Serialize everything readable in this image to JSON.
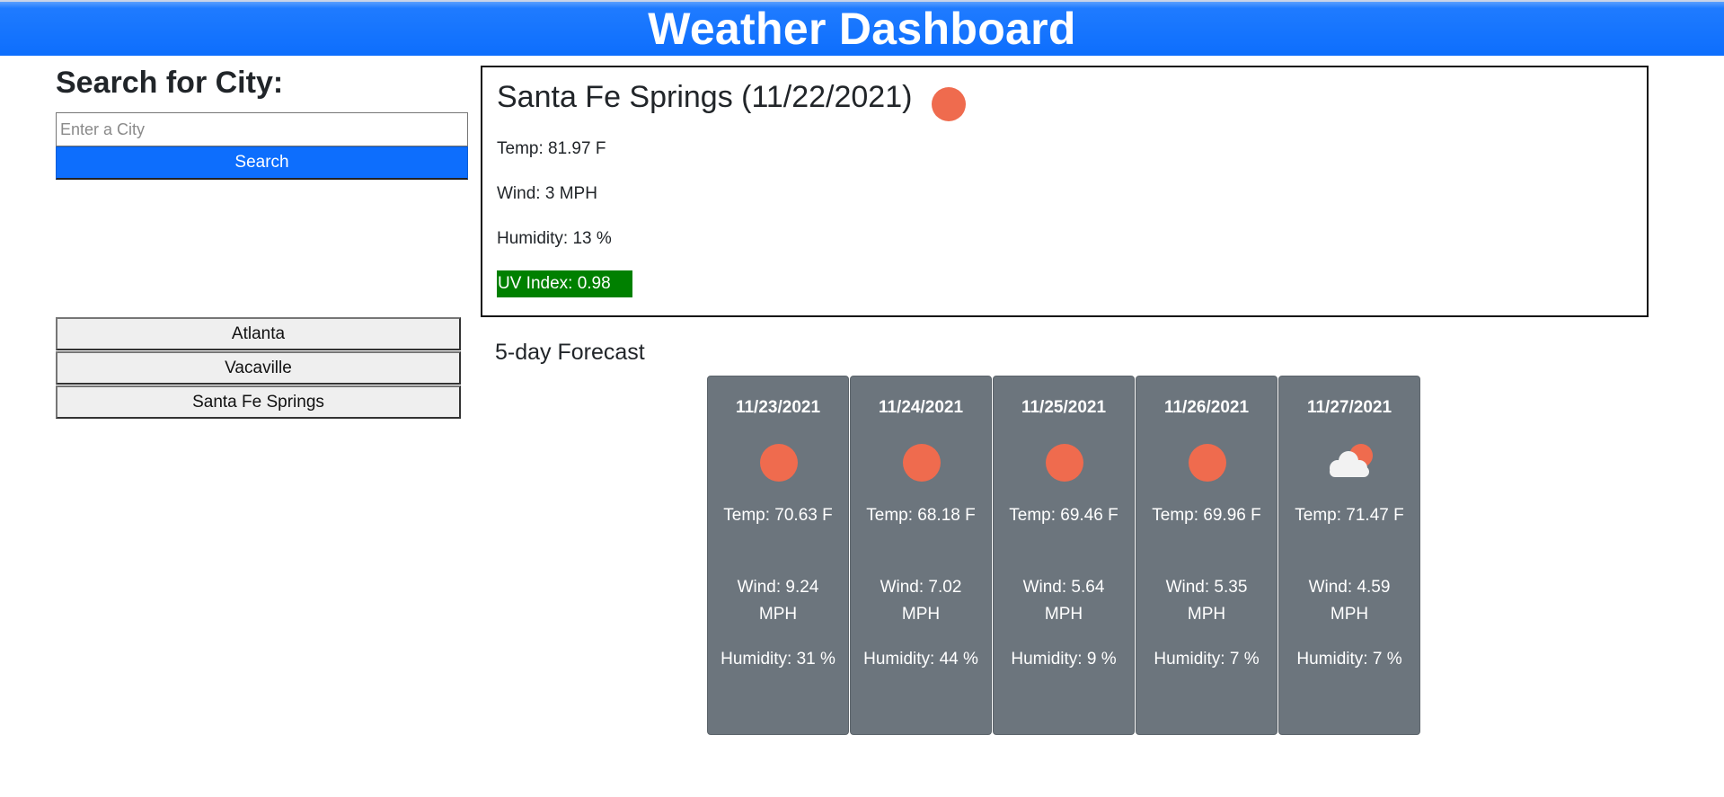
{
  "header": {
    "title": "Weather Dashboard"
  },
  "search": {
    "title": "Search for City:",
    "placeholder": "Enter a City",
    "value": "",
    "button_label": "Search"
  },
  "history": [
    "Atlanta",
    "Vacaville",
    "Santa Fe Springs"
  ],
  "current": {
    "title": "Santa Fe Springs (11/22/2021)",
    "icon": "sun-icon",
    "temp": "Temp: 81.97 F",
    "wind": "Wind: 3 MPH",
    "humidity": "Humidity: 13 %",
    "uv": "UV Index: 0.98",
    "uv_color": "#008000"
  },
  "forecast": {
    "title": "5-day Forecast",
    "days": [
      {
        "date": "11/23/2021",
        "icon": "sun-icon",
        "temp": "Temp: 70.63 F",
        "wind": "Wind: 9.24 MPH",
        "humidity": "Humidity: 31 %"
      },
      {
        "date": "11/24/2021",
        "icon": "sun-icon",
        "temp": "Temp: 68.18 F",
        "wind": "Wind: 7.02 MPH",
        "humidity": "Humidity: 44 %"
      },
      {
        "date": "11/25/2021",
        "icon": "sun-icon",
        "temp": "Temp: 69.46 F",
        "wind": "Wind: 5.64 MPH",
        "humidity": "Humidity: 9 %"
      },
      {
        "date": "11/26/2021",
        "icon": "sun-icon",
        "temp": "Temp: 69.96 F",
        "wind": "Wind: 5.35 MPH",
        "humidity": "Humidity: 7 %"
      },
      {
        "date": "11/27/2021",
        "icon": "cloud-sun-icon",
        "temp": "Temp: 71.47 F",
        "wind": "Wind: 4.59 MPH",
        "humidity": "Humidity: 7 %"
      }
    ]
  },
  "colors": {
    "header_blue": "#0d6efd",
    "card_gray": "#6c757d",
    "sun": "#ef6b4e"
  }
}
